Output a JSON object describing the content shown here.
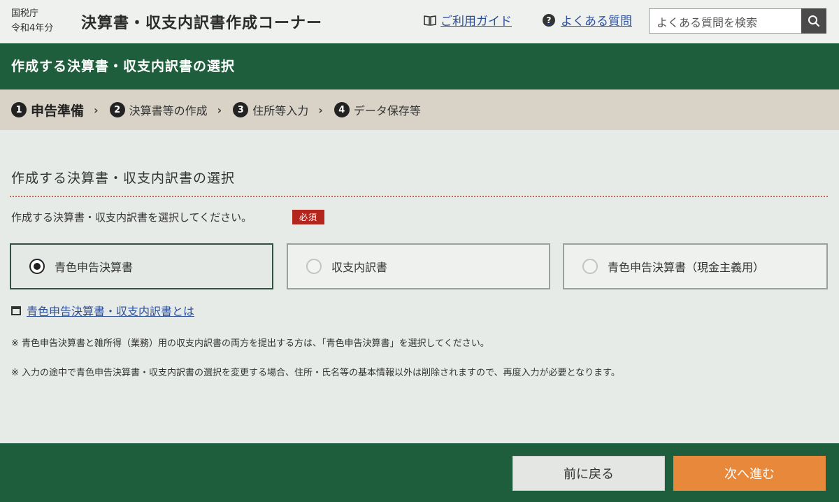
{
  "header": {
    "agency": "国税庁",
    "year": "令和4年分",
    "app_title": "決算書・収支内訳書作成コーナー",
    "guide_label": "ご利用ガイド",
    "faq_label": "よくある質問",
    "search_placeholder": "よくある質問を検索"
  },
  "page_title": "作成する決算書・収支内訳書の選択",
  "steps": [
    {
      "num": "1",
      "label": "申告準備"
    },
    {
      "num": "2",
      "label": "決算書等の作成"
    },
    {
      "num": "3",
      "label": "住所等入力"
    },
    {
      "num": "4",
      "label": "データ保存等"
    }
  ],
  "section": {
    "title": "作成する決算書・収支内訳書の選択",
    "instruction": "作成する決算書・収支内訳書を選択してください。",
    "required_label": "必須",
    "options": [
      {
        "label": "青色申告決算書",
        "selected": true
      },
      {
        "label": "収支内訳書",
        "selected": false
      },
      {
        "label": "青色申告決算書（現金主義用）",
        "selected": false
      }
    ],
    "about_link": "青色申告決算書・収支内訳書とは",
    "notes": [
      "※ 青色申告決算書と雑所得（業務）用の収支内訳書の両方を提出する方は、「青色申告決算書」を選択してください。",
      "※ 入力の途中で青色申告決算書・収支内訳書の選択を変更する場合、住所・氏名等の基本情報以外は削除されますので、再度入力が必要となります。"
    ]
  },
  "footer": {
    "back_label": "前に戻る",
    "next_label": "次へ進む"
  },
  "colors": {
    "brand_green": "#1f5e3c",
    "step_band": "#d8d3c6",
    "required_red": "#b3261e",
    "next_orange": "#e8883a",
    "link_blue": "#2d4f9a"
  }
}
